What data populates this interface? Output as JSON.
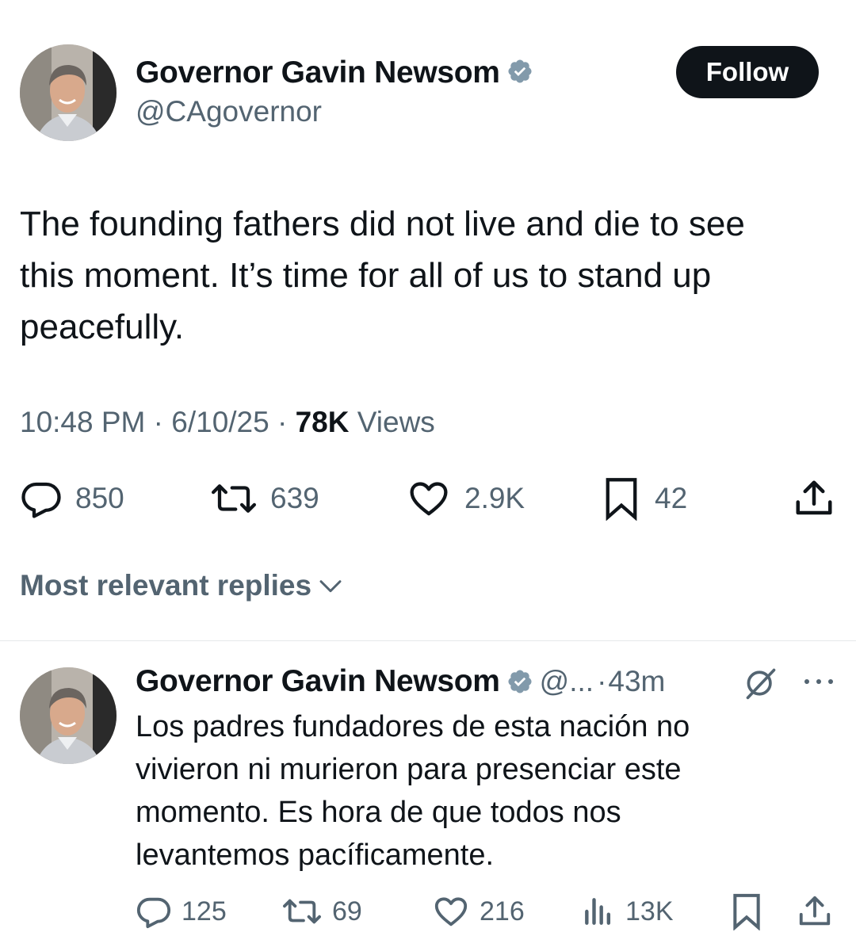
{
  "tweet": {
    "author_name": "Governor Gavin Newsom",
    "handle": "@CAgovernor",
    "follow_label": "Follow",
    "text_lines": [
      "The founding fathers did not live and die to see",
      "this moment. It’s time for all of us to stand up",
      "peacefully."
    ],
    "time": "10:48 PM",
    "date": "6/10/25",
    "views_count": "78K",
    "views_label": "Views",
    "separator": "·",
    "replies": "850",
    "reposts": "639",
    "likes": "2.9K",
    "bookmarks": "42"
  },
  "replies_section": {
    "sort_label": "Most relevant replies"
  },
  "reply": {
    "author_name": "Governor Gavin Newsom",
    "handle": "@...",
    "separator": "·",
    "age": "43m",
    "text_lines": [
      "Los padres fundadores de esta nación no",
      "vivieron ni murieron para presenciar este",
      "momento. Es hora de que todos nos",
      "levantemos pacíficamente."
    ],
    "replies": "125",
    "reposts": "69",
    "likes": "216",
    "views": "13K"
  },
  "colors": {
    "text_primary": "#0f1419",
    "text_secondary": "#536471",
    "verified": "#829aab",
    "follow_bg": "#0f1419"
  },
  "icons": [
    "verified-badge-icon",
    "reply-icon",
    "repost-icon",
    "like-icon",
    "bookmark-icon",
    "share-icon",
    "chevron-down-icon",
    "grok-icon",
    "more-icon",
    "views-icon"
  ]
}
